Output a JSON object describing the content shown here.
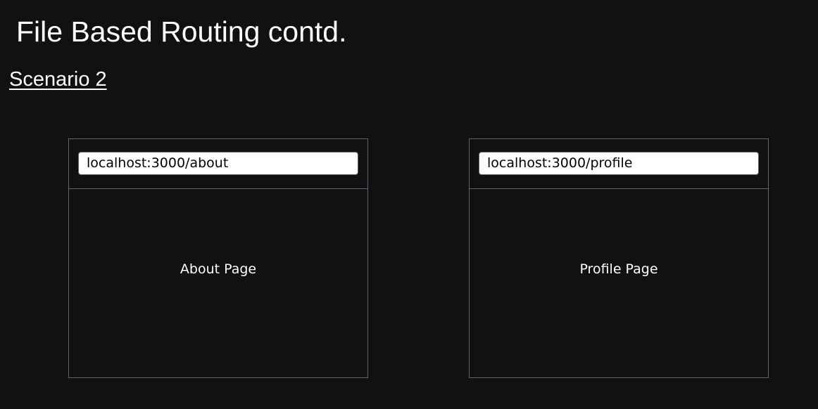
{
  "slide": {
    "title": "File Based Routing contd.",
    "subtitle": "Scenario 2"
  },
  "browsers": [
    {
      "url": "localhost:3000/about",
      "page_label": "About Page"
    },
    {
      "url": "localhost:3000/profile",
      "page_label": "Profile Page"
    }
  ]
}
